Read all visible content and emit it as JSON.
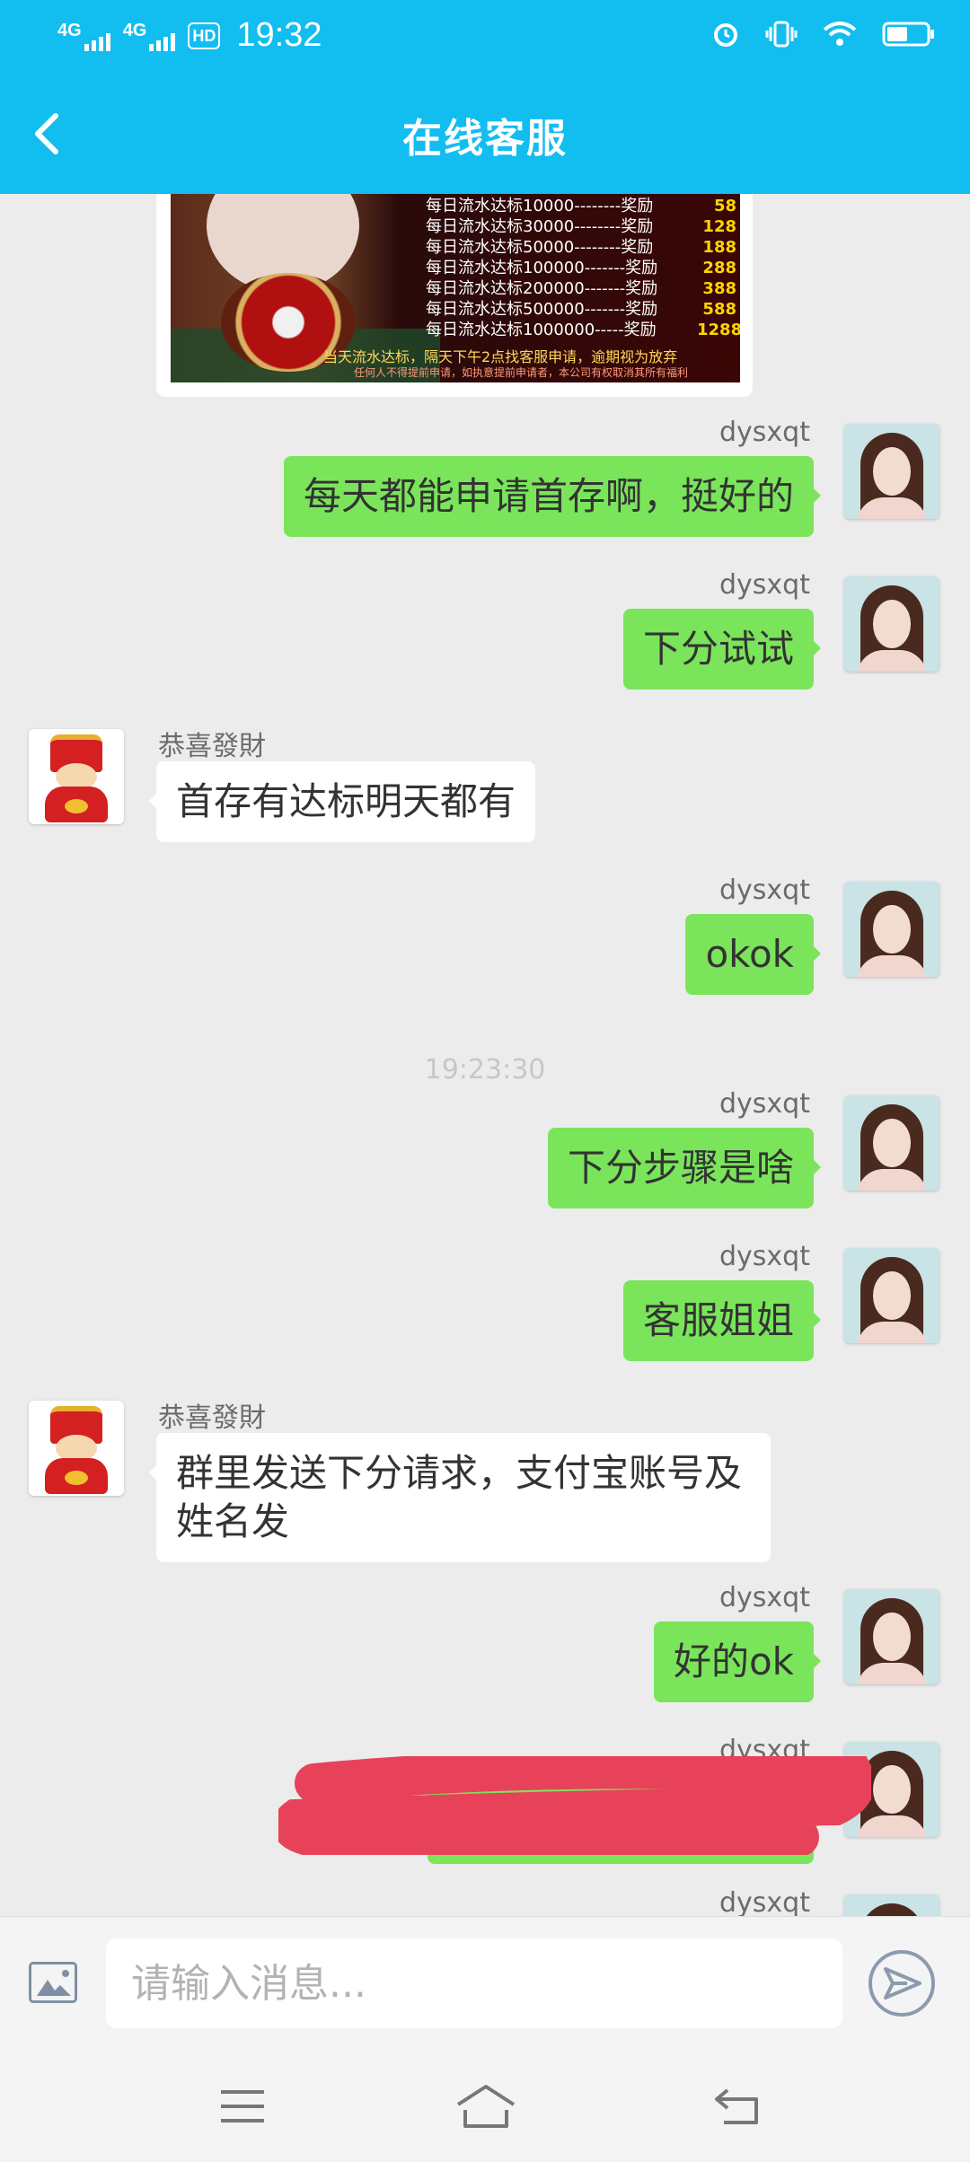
{
  "status_bar": {
    "net1": "4G",
    "net2": "4G",
    "hd": "HD",
    "time": "19:32"
  },
  "header": {
    "title": "在线客服"
  },
  "poster": {
    "rewards": [
      {
        "label": "每日流水达标10000--------奖励",
        "amount": "58"
      },
      {
        "label": "每日流水达标30000--------奖励",
        "amount": "128"
      },
      {
        "label": "每日流水达标50000--------奖励",
        "amount": "188"
      },
      {
        "label": "每日流水达标100000-------奖励",
        "amount": "288"
      },
      {
        "label": "每日流水达标200000-------奖励",
        "amount": "388"
      },
      {
        "label": "每日流水达标500000-------奖励",
        "amount": "588"
      },
      {
        "label": "每日流水达标1000000-----奖励",
        "amount": "1288"
      }
    ],
    "note": "当天流水达标，隔天下午2点找客服申请，逾期视为放弃",
    "fine_print": "任何人不得提前申请，如执意提前申请者，本公司有权取消其所有福利"
  },
  "messages": [
    {
      "sender": "dysxqt",
      "text": "每天都能申请首存啊，挺好的"
    },
    {
      "sender": "dysxqt",
      "text": "下分试试"
    },
    {
      "sender": "恭喜發財",
      "text": "首存有达标明天都有"
    },
    {
      "sender": "dysxqt",
      "text": "okok"
    },
    {
      "sender": "dysxqt",
      "text": "下分步骤是啥"
    },
    {
      "sender": "dysxqt",
      "text": "客服姐姐"
    },
    {
      "sender": "恭喜發財",
      "text": "群里发送下分请求，支付宝账号及姓名发"
    },
    {
      "sender": "dysxqt",
      "text": "好的ok"
    },
    {
      "sender": "dysxqt",
      "text": ""
    },
    {
      "sender": "dysxqt",
      "text": ""
    }
  ],
  "timestamp": "19:23:30",
  "input": {
    "placeholder": "请输入消息..."
  },
  "colors": {
    "header": "#12bdf0",
    "my_bubble": "#7ae55a",
    "redaction": "#e8425a"
  }
}
